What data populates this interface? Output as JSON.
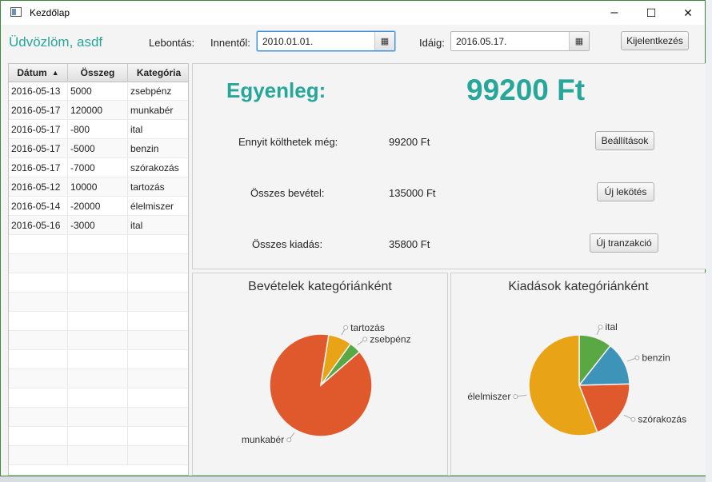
{
  "window": {
    "title": "Kezdőlap",
    "minimize": "–",
    "maximize": "☐",
    "close": "✕"
  },
  "toolbar": {
    "welcome": "Üdvözlöm, asdf",
    "filter_label": "Lebontás:",
    "from_label": "Innentől:",
    "from_value": "2010.01.01.",
    "to_label": "Idáig:",
    "to_value": "2016.05.17.",
    "logout": "Kijelentkezés"
  },
  "table": {
    "headers": [
      "Dátum",
      "Összeg",
      "Kategória"
    ],
    "sort_indicator": "▲",
    "rows": [
      [
        "2016-05-13",
        "5000",
        "zsebpénz"
      ],
      [
        "2016-05-17",
        "120000",
        "munkabér"
      ],
      [
        "2016-05-17",
        "-800",
        "ital"
      ],
      [
        "2016-05-17",
        "-5000",
        "benzin"
      ],
      [
        "2016-05-17",
        "-7000",
        "szórakozás"
      ],
      [
        "2016-05-12",
        "10000",
        "tartozás"
      ],
      [
        "2016-05-14",
        "-20000",
        "élelmiszer"
      ],
      [
        "2016-05-16",
        "-3000",
        "ital"
      ]
    ]
  },
  "summary": {
    "balance_label": "Egyenleg:",
    "balance_value": "99200 Ft",
    "remaining_label": "Ennyit költhetek még:",
    "remaining_value": "99200 Ft",
    "settings_button": "Beállítások",
    "income_label": "Összes bevétel:",
    "income_value": "135000 Ft",
    "new_deposit_button": "Új lekötés",
    "expense_label": "Összes kiadás:",
    "expense_value": "35800 Ft",
    "new_transaction_button": "Új tranzakció"
  },
  "chart_data": [
    {
      "type": "pie",
      "title": "Bevételek kategóriánként",
      "categories": [
        "munkabér",
        "tartozás",
        "zsebpénz"
      ],
      "values": [
        120000,
        10000,
        5000
      ],
      "colors": [
        "#e0592d",
        "#e8a316",
        "#5aa844"
      ]
    },
    {
      "type": "pie",
      "title": "Kiadások kategóriánként",
      "categories": [
        "ital",
        "benzin",
        "szórakozás",
        "élelmiszer"
      ],
      "values": [
        3800,
        5000,
        7000,
        20000
      ],
      "colors": [
        "#5aa844",
        "#3d94b8",
        "#e0592d",
        "#e8a316"
      ]
    }
  ],
  "icons": {
    "calendar": "calendar-icon",
    "app": "window-icon"
  },
  "colors": {
    "accent": "#27a69a"
  }
}
